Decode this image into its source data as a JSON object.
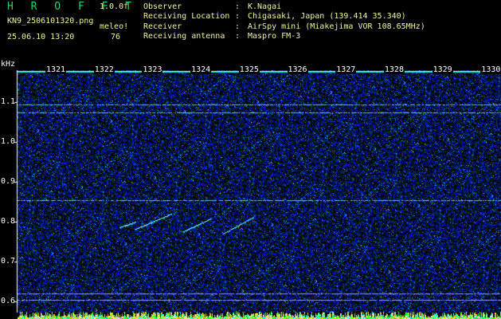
{
  "header": {
    "title": "H R O F F T",
    "version": "1.0.0f",
    "filename": "KN9_2506101320.png",
    "meleor_label": "meleo!",
    "datetime": "25.06.10 13:20",
    "count": "76"
  },
  "info": [
    {
      "label": "Observer",
      "value": "K.Nagai"
    },
    {
      "label": "Receiving Location",
      "value": "Chigasaki, Japan (139.414 35.340)"
    },
    {
      "label": "Receiver",
      "value": "AirSpy mini (Miakejima VOR 108.65MHz)"
    },
    {
      "label": "Receiving antenna",
      "value": "Maspro FM-3"
    }
  ],
  "chart_data": {
    "type": "heatmap",
    "ylabel": "kHz",
    "y_ticks": [
      "1.1",
      "1.0",
      "0.9",
      "0.8",
      "0.7",
      "0.6"
    ],
    "ylim": [
      0.58,
      1.18
    ],
    "x_ticks": [
      "1321",
      "1322",
      "1323",
      "1324",
      "1325",
      "1326",
      "1327",
      "1328",
      "1329",
      "1330"
    ],
    "colors": {
      "background": "#000000",
      "noise": "#0a2a9a",
      "signal": "#00ffff",
      "hot": "#ffff00"
    },
    "horizontal_signals_khz": [
      1.095,
      1.075,
      0.855,
      0.62,
      0.605
    ]
  }
}
